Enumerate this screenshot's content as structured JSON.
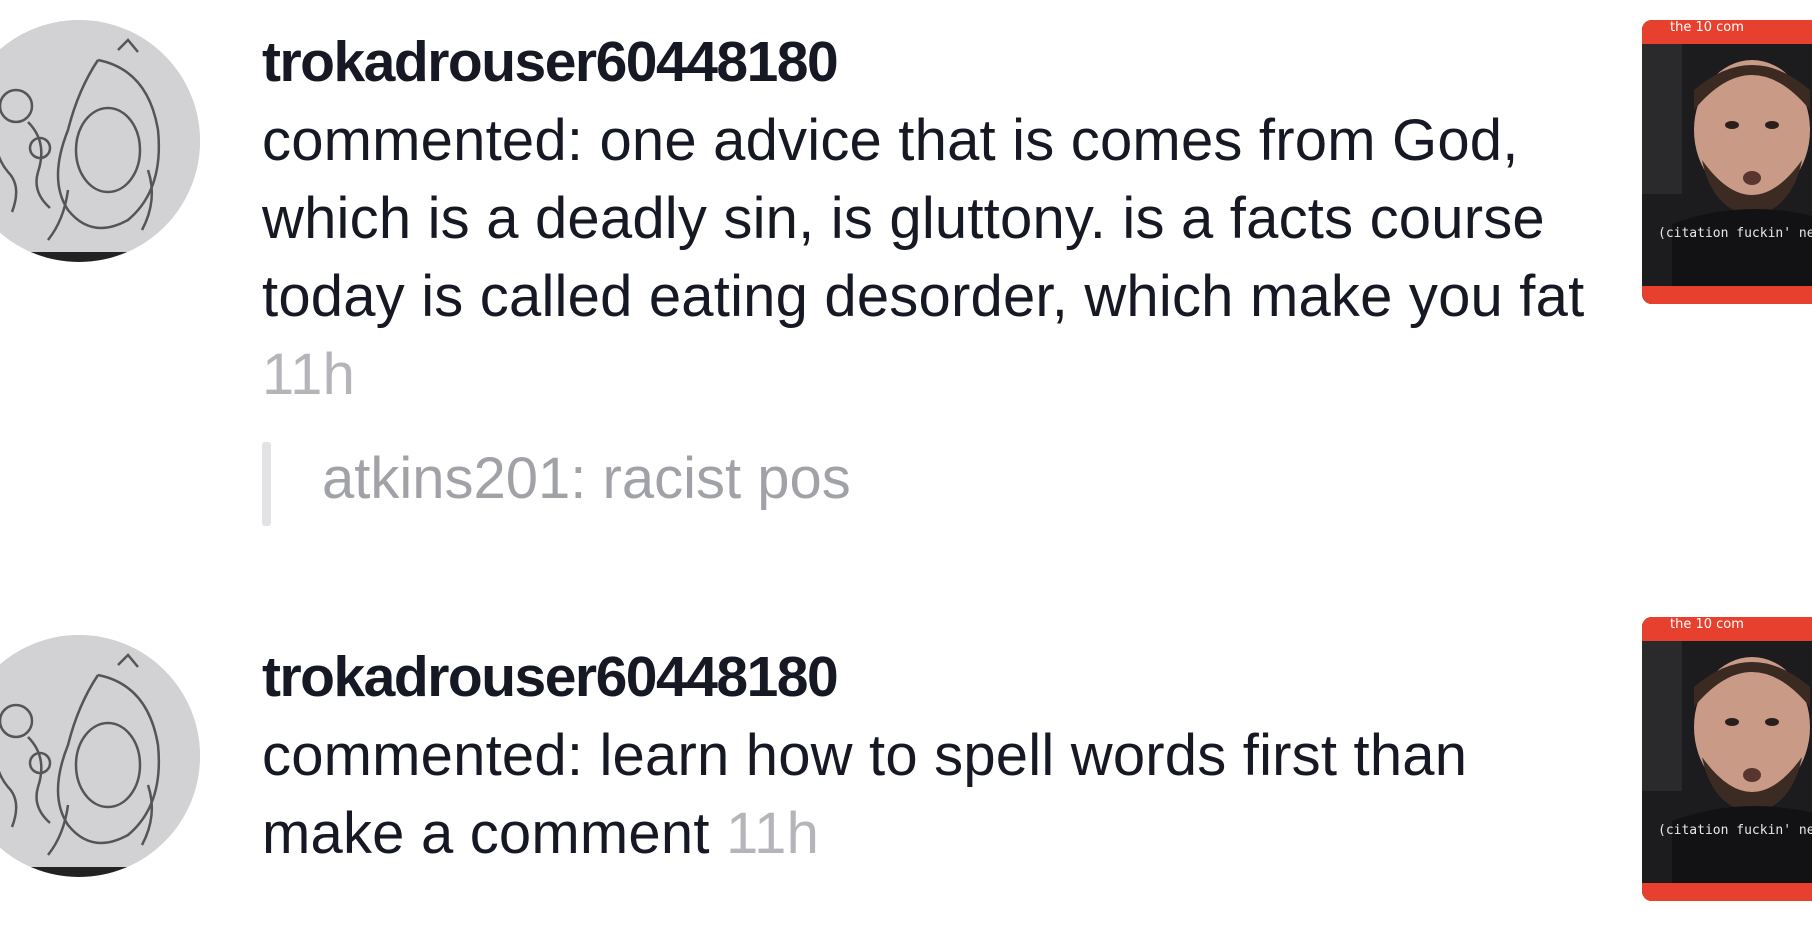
{
  "notifications": [
    {
      "username": "trokadrouser60448180",
      "comment": "commented: one advice that is comes from God, which is a deadly sin, is gluttony. is a facts course today is called eating desorder, which make you fat",
      "time": "11h",
      "reply": "atkins201: racist pos",
      "thumbnail_caption": "(citation fuckin' nee",
      "thumbnail_header": "the 10 com"
    },
    {
      "username": "trokadrouser60448180",
      "comment": "commented: learn how to spell words first than make a comment",
      "time": "11h",
      "thumbnail_caption": "(citation fuckin' nee",
      "thumbnail_header": "the 10 com"
    }
  ],
  "colors": {
    "username": "#161823",
    "timestamp": "#b4b5b9",
    "reply": "#a1a2a7",
    "thumb_accent": "#e8402f"
  },
  "icons": {
    "avatar": "sketch-avatar",
    "thumbnail": "video-thumbnail"
  }
}
